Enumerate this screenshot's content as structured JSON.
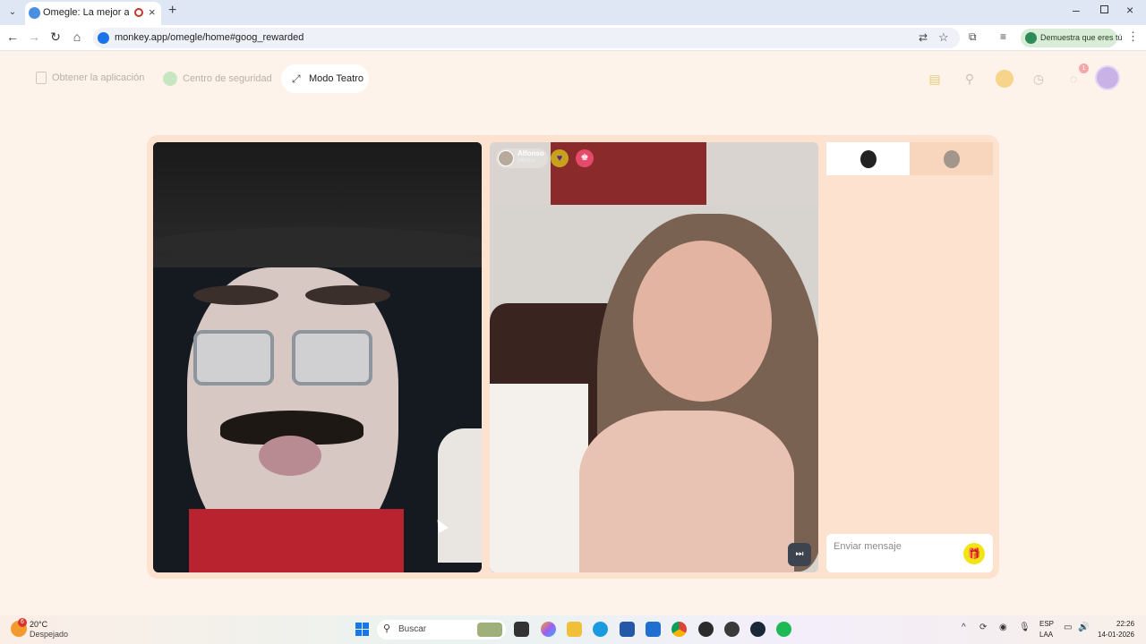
{
  "browser": {
    "tab_title": "Omegle: La mejor alternati",
    "url": "monkey.app/omegle/home#goog_rewarded",
    "profile_button": "Demuestra que eres tú",
    "icons": {
      "back": "arrow-left",
      "forward": "arrow-right",
      "reload": "reload",
      "home": "home",
      "translate": "translate",
      "bookmark": "star",
      "extensions": "puzzle",
      "media": "media-control",
      "more": "kebab"
    }
  },
  "header": {
    "get_app": "Obtener la aplicación",
    "safety_center": "Centro de seguridad",
    "theatre_mode": "Modo Teatro",
    "notification_count": "1"
  },
  "peer": {
    "name": "Alfonso",
    "country": "México"
  },
  "chat": {
    "placeholder": "Enviar mensaje"
  },
  "taskbar": {
    "weather_badge": "6",
    "temperature": "20°C",
    "weather": "Despejado",
    "search_label": "Buscar",
    "lang_primary": "ESP",
    "lang_secondary": "LAA",
    "time": "22:26",
    "date": "14-01-2026"
  },
  "colors": {
    "page_bg": "#fdf3ea",
    "stage_bg": "#fce2cf",
    "accent_gift": "#f1e51a"
  }
}
